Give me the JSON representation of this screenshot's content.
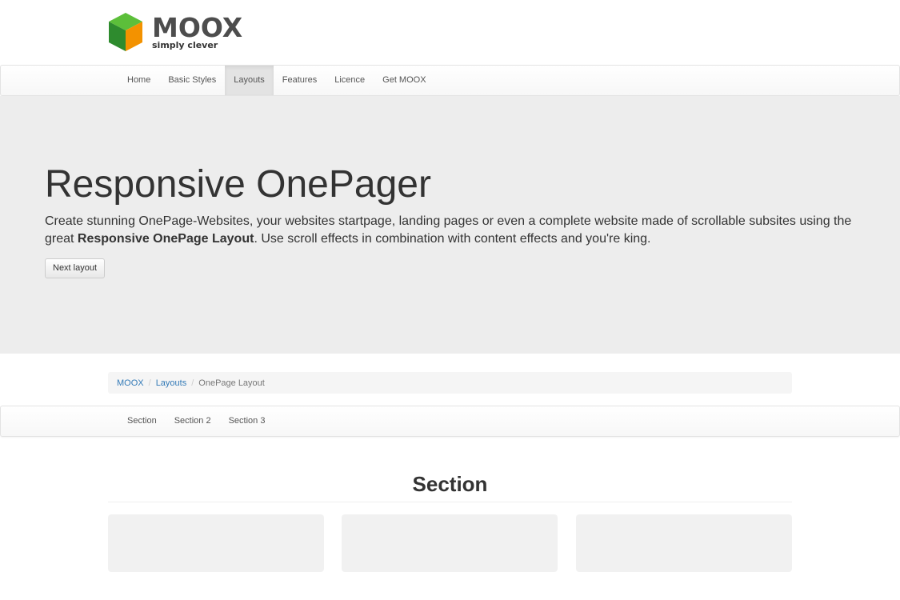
{
  "brand": {
    "name": "MOOX",
    "tagline": "simply clever",
    "colors": {
      "cube_green": "#3aa935",
      "cube_dark_green": "#2a7f2a",
      "cube_orange": "#f39200",
      "wordmark": "#4d4d4d"
    }
  },
  "main_nav": {
    "items": [
      {
        "label": "Home"
      },
      {
        "label": "Basic Styles"
      },
      {
        "label": "Layouts",
        "active": true
      },
      {
        "label": "Features"
      },
      {
        "label": "Licence"
      },
      {
        "label": "Get MOOX"
      }
    ]
  },
  "hero": {
    "title": "Responsive OnePager",
    "text_before": "Create stunning OnePage-Websites, your websites startpage, landing pages or even a complete website made of scrollable subsites using the great ",
    "text_bold": "Responsive OnePage Layout",
    "text_after": ". Use scroll effects in combination with content effects and you're king.",
    "button_label": "Next layout"
  },
  "breadcrumb": {
    "items": [
      {
        "label": "MOOX",
        "link": true
      },
      {
        "label": "Layouts",
        "link": true
      },
      {
        "label": "OnePage Layout",
        "link": false
      }
    ],
    "separator": "/"
  },
  "section_nav": {
    "items": [
      {
        "label": "Section"
      },
      {
        "label": "Section 2"
      },
      {
        "label": "Section 3"
      }
    ]
  },
  "section": {
    "title": "Section"
  }
}
